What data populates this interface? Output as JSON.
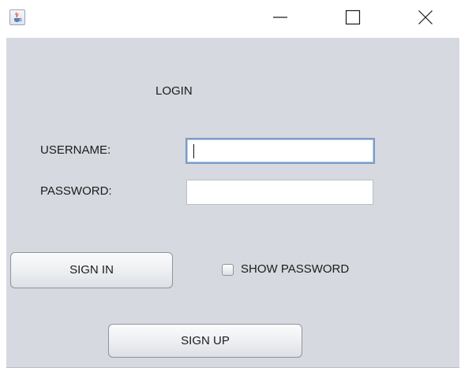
{
  "window": {
    "title_icon": "java-cup-icon",
    "controls": {
      "minimize_icon": "minimize-icon",
      "maximize_icon": "maximize-icon",
      "close_icon": "close-icon"
    }
  },
  "form": {
    "title": "LOGIN",
    "username": {
      "label": "USERNAME:",
      "value": "",
      "focused": true
    },
    "password": {
      "label": "PASSWORD:",
      "value": ""
    },
    "sign_in_label": "SIGN IN",
    "show_password": {
      "label": "SHOW PASSWORD",
      "checked": false
    },
    "sign_up_label": "SIGN UP"
  },
  "colors": {
    "panel_background": "#d6d9df",
    "focus_border": "#7a9cc6"
  }
}
